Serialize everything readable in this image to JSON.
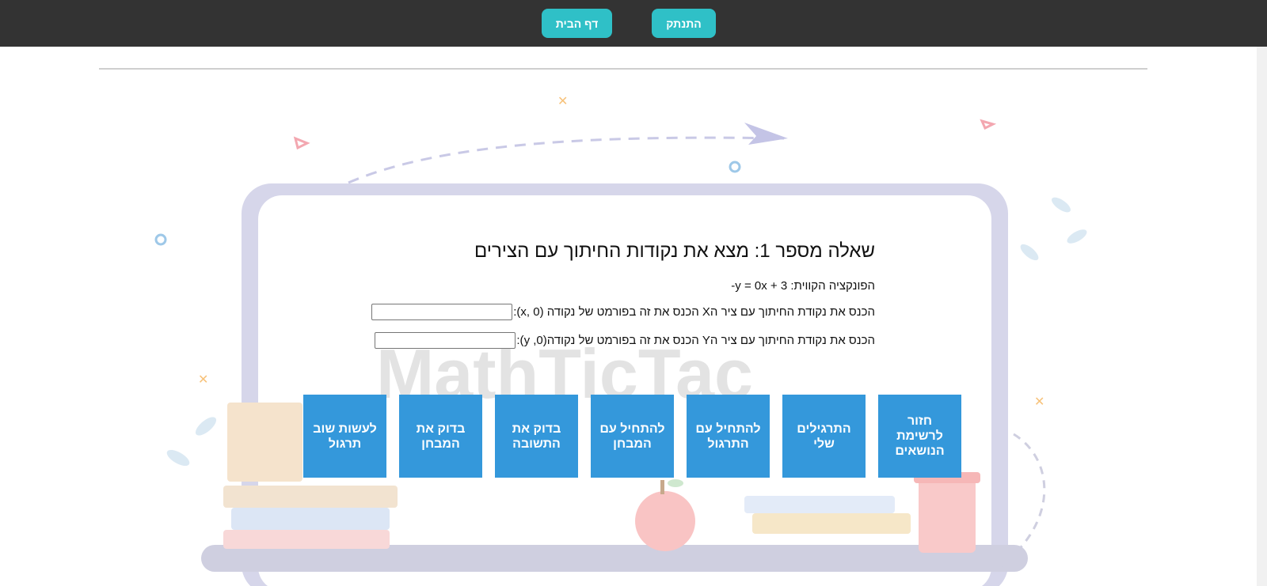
{
  "topbar": {
    "logout_label": "התנתק",
    "home_label": "דף הבית"
  },
  "background": {
    "watermark": "MathTicTac"
  },
  "question": {
    "title": "שאלה מספר 1: מצא את נקודות החיתוך עם הצירים",
    "function_text": "הפונקציה הקווית: y = 0x + 3-",
    "x_prompt": "הכנס את נקודת החיתוך עם ציר הX הכנס את זה בפורמט של נקודה (x, 0):",
    "x_value": "",
    "y_prompt": "הכנס את נקודת החיתוך עם ציר הY הכנס את זה בפורמט של נקודה(0, y):",
    "y_value": ""
  },
  "actions": [
    "חזור לרשימת הנושאים",
    "התרגילים שלי",
    "להתחיל עם התרגול",
    "להתחיל עם המבחן",
    "בדוק את התשובה",
    "בדוק את המבחן",
    "לעשות שוב תרגול"
  ],
  "colors": {
    "topbar": "#333333",
    "top_button": "#2fc0c7",
    "tile": "#3498db"
  }
}
